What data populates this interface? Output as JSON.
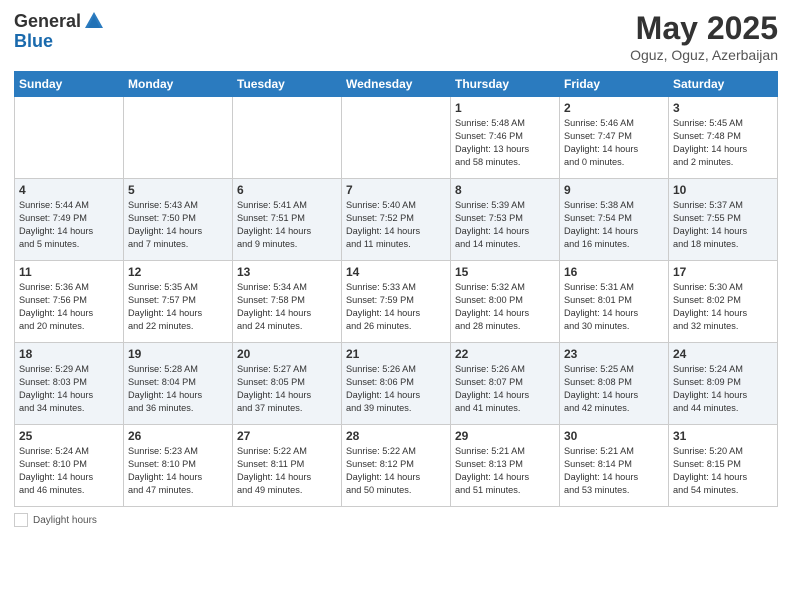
{
  "header": {
    "logo_general": "General",
    "logo_blue": "Blue",
    "title": "May 2025",
    "location": "Oguz, Oguz, Azerbaijan"
  },
  "footer": {
    "daylight_label": "Daylight hours"
  },
  "weekdays": [
    "Sunday",
    "Monday",
    "Tuesday",
    "Wednesday",
    "Thursday",
    "Friday",
    "Saturday"
  ],
  "weeks": [
    [
      {
        "day": "",
        "info": ""
      },
      {
        "day": "",
        "info": ""
      },
      {
        "day": "",
        "info": ""
      },
      {
        "day": "",
        "info": ""
      },
      {
        "day": "1",
        "info": "Sunrise: 5:48 AM\nSunset: 7:46 PM\nDaylight: 13 hours\nand 58 minutes."
      },
      {
        "day": "2",
        "info": "Sunrise: 5:46 AM\nSunset: 7:47 PM\nDaylight: 14 hours\nand 0 minutes."
      },
      {
        "day": "3",
        "info": "Sunrise: 5:45 AM\nSunset: 7:48 PM\nDaylight: 14 hours\nand 2 minutes."
      }
    ],
    [
      {
        "day": "4",
        "info": "Sunrise: 5:44 AM\nSunset: 7:49 PM\nDaylight: 14 hours\nand 5 minutes."
      },
      {
        "day": "5",
        "info": "Sunrise: 5:43 AM\nSunset: 7:50 PM\nDaylight: 14 hours\nand 7 minutes."
      },
      {
        "day": "6",
        "info": "Sunrise: 5:41 AM\nSunset: 7:51 PM\nDaylight: 14 hours\nand 9 minutes."
      },
      {
        "day": "7",
        "info": "Sunrise: 5:40 AM\nSunset: 7:52 PM\nDaylight: 14 hours\nand 11 minutes."
      },
      {
        "day": "8",
        "info": "Sunrise: 5:39 AM\nSunset: 7:53 PM\nDaylight: 14 hours\nand 14 minutes."
      },
      {
        "day": "9",
        "info": "Sunrise: 5:38 AM\nSunset: 7:54 PM\nDaylight: 14 hours\nand 16 minutes."
      },
      {
        "day": "10",
        "info": "Sunrise: 5:37 AM\nSunset: 7:55 PM\nDaylight: 14 hours\nand 18 minutes."
      }
    ],
    [
      {
        "day": "11",
        "info": "Sunrise: 5:36 AM\nSunset: 7:56 PM\nDaylight: 14 hours\nand 20 minutes."
      },
      {
        "day": "12",
        "info": "Sunrise: 5:35 AM\nSunset: 7:57 PM\nDaylight: 14 hours\nand 22 minutes."
      },
      {
        "day": "13",
        "info": "Sunrise: 5:34 AM\nSunset: 7:58 PM\nDaylight: 14 hours\nand 24 minutes."
      },
      {
        "day": "14",
        "info": "Sunrise: 5:33 AM\nSunset: 7:59 PM\nDaylight: 14 hours\nand 26 minutes."
      },
      {
        "day": "15",
        "info": "Sunrise: 5:32 AM\nSunset: 8:00 PM\nDaylight: 14 hours\nand 28 minutes."
      },
      {
        "day": "16",
        "info": "Sunrise: 5:31 AM\nSunset: 8:01 PM\nDaylight: 14 hours\nand 30 minutes."
      },
      {
        "day": "17",
        "info": "Sunrise: 5:30 AM\nSunset: 8:02 PM\nDaylight: 14 hours\nand 32 minutes."
      }
    ],
    [
      {
        "day": "18",
        "info": "Sunrise: 5:29 AM\nSunset: 8:03 PM\nDaylight: 14 hours\nand 34 minutes."
      },
      {
        "day": "19",
        "info": "Sunrise: 5:28 AM\nSunset: 8:04 PM\nDaylight: 14 hours\nand 36 minutes."
      },
      {
        "day": "20",
        "info": "Sunrise: 5:27 AM\nSunset: 8:05 PM\nDaylight: 14 hours\nand 37 minutes."
      },
      {
        "day": "21",
        "info": "Sunrise: 5:26 AM\nSunset: 8:06 PM\nDaylight: 14 hours\nand 39 minutes."
      },
      {
        "day": "22",
        "info": "Sunrise: 5:26 AM\nSunset: 8:07 PM\nDaylight: 14 hours\nand 41 minutes."
      },
      {
        "day": "23",
        "info": "Sunrise: 5:25 AM\nSunset: 8:08 PM\nDaylight: 14 hours\nand 42 minutes."
      },
      {
        "day": "24",
        "info": "Sunrise: 5:24 AM\nSunset: 8:09 PM\nDaylight: 14 hours\nand 44 minutes."
      }
    ],
    [
      {
        "day": "25",
        "info": "Sunrise: 5:24 AM\nSunset: 8:10 PM\nDaylight: 14 hours\nand 46 minutes."
      },
      {
        "day": "26",
        "info": "Sunrise: 5:23 AM\nSunset: 8:10 PM\nDaylight: 14 hours\nand 47 minutes."
      },
      {
        "day": "27",
        "info": "Sunrise: 5:22 AM\nSunset: 8:11 PM\nDaylight: 14 hours\nand 49 minutes."
      },
      {
        "day": "28",
        "info": "Sunrise: 5:22 AM\nSunset: 8:12 PM\nDaylight: 14 hours\nand 50 minutes."
      },
      {
        "day": "29",
        "info": "Sunrise: 5:21 AM\nSunset: 8:13 PM\nDaylight: 14 hours\nand 51 minutes."
      },
      {
        "day": "30",
        "info": "Sunrise: 5:21 AM\nSunset: 8:14 PM\nDaylight: 14 hours\nand 53 minutes."
      },
      {
        "day": "31",
        "info": "Sunrise: 5:20 AM\nSunset: 8:15 PM\nDaylight: 14 hours\nand 54 minutes."
      }
    ]
  ]
}
